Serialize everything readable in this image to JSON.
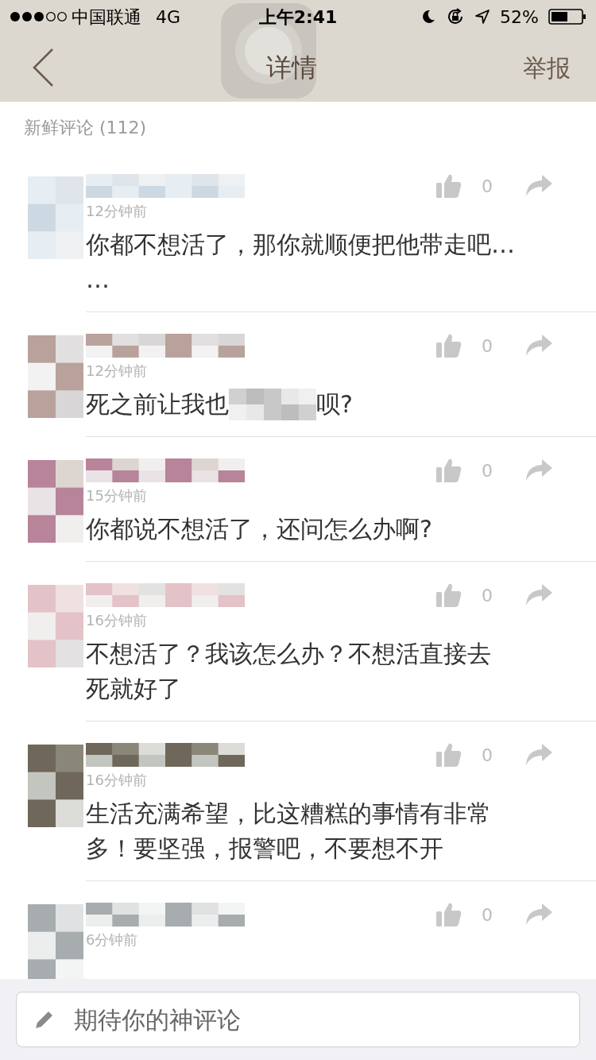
{
  "status_bar": {
    "carrier": "中国联通",
    "network": "4G",
    "time": "上午2:41",
    "battery": "52%"
  },
  "nav": {
    "title": "详情",
    "action": "举报"
  },
  "section_title": "新鲜评论 (112)",
  "comments": [
    {
      "time": "12分钟前",
      "likes": "0",
      "text": [
        {
          "kind": "text",
          "value": "你都不想活了，那你就顺便把他带走吧…"
        },
        {
          "kind": "break"
        },
        {
          "kind": "text",
          "value": "…"
        }
      ]
    },
    {
      "time": "12分钟前",
      "likes": "0",
      "text": [
        {
          "kind": "text",
          "value": "死之前让我也"
        },
        {
          "kind": "mosaic"
        },
        {
          "kind": "text",
          "value": "呗?"
        }
      ]
    },
    {
      "time": "15分钟前",
      "likes": "0",
      "text": [
        {
          "kind": "text",
          "value": "你都说不想活了，还问怎么办啊?"
        }
      ]
    },
    {
      "time": "16分钟前",
      "likes": "0",
      "text": [
        {
          "kind": "text",
          "value": "不想活了？我该怎么办？不想活直接去"
        },
        {
          "kind": "break"
        },
        {
          "kind": "text",
          "value": "死就好了"
        }
      ]
    },
    {
      "time": "16分钟前",
      "likes": "0",
      "text": [
        {
          "kind": "text",
          "value": "生活充满希望，比这糟糕的事情有非常"
        },
        {
          "kind": "break"
        },
        {
          "kind": "text",
          "value": "多！要坚强，报警吧，不要想不开"
        }
      ]
    },
    {
      "time": "6分钟前",
      "likes": "0"
    }
  ],
  "comment_box": {
    "placeholder": "期待你的神评论"
  }
}
